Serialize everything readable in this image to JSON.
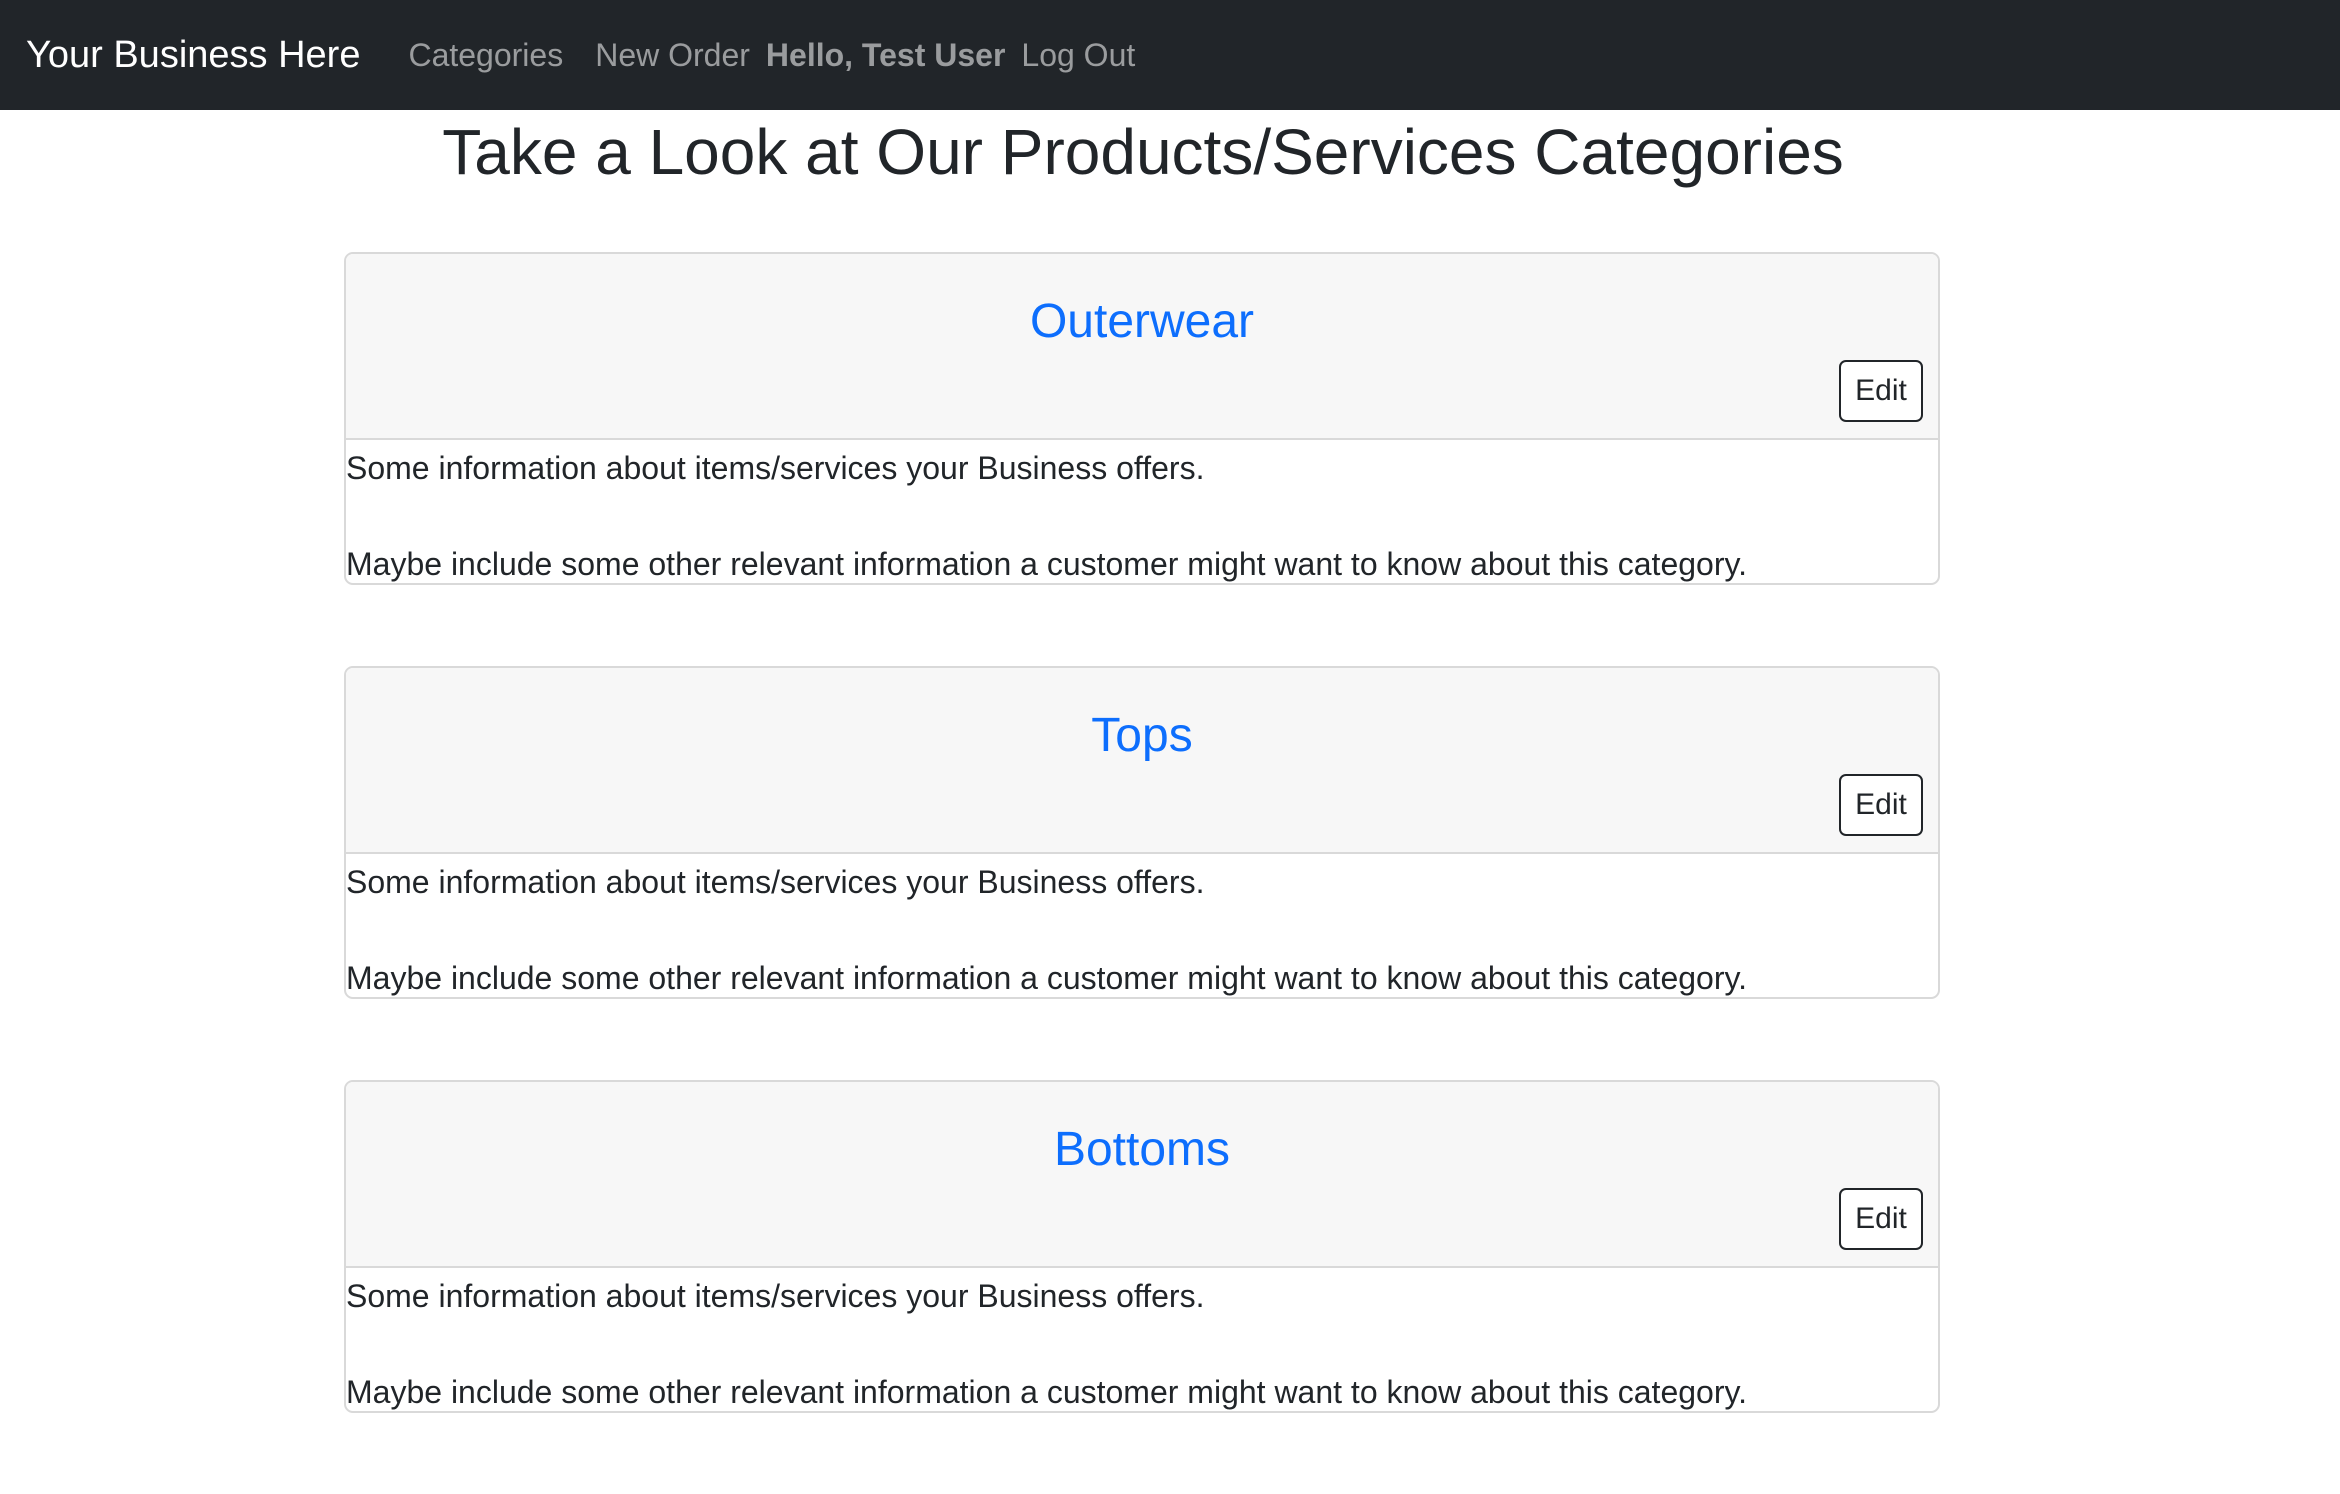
{
  "navbar": {
    "brand": "Your Business Here",
    "links": [
      "Categories",
      "New Order"
    ],
    "greeting": "Hello, Test User",
    "logout": "Log Out"
  },
  "page": {
    "title": "Take a Look at Our Products/Services Categories"
  },
  "categories": [
    {
      "name": "Outerwear",
      "edit_label": "Edit",
      "description_1": "Some information about items/services your Business offers.",
      "description_2": "Maybe include some other relevant information a customer might want to know about this category."
    },
    {
      "name": "Tops",
      "edit_label": "Edit",
      "description_1": "Some information about items/services your Business offers.",
      "description_2": "Maybe include some other relevant information a customer might want to know about this category."
    },
    {
      "name": "Bottoms",
      "edit_label": "Edit",
      "description_1": "Some information about items/services your Business offers.",
      "description_2": "Maybe include some other relevant information a customer might want to know about this category."
    }
  ],
  "colors": {
    "navbar_bg": "#212529",
    "link_blue": "#0d6efd",
    "card_header_bg": "#f7f7f7"
  }
}
